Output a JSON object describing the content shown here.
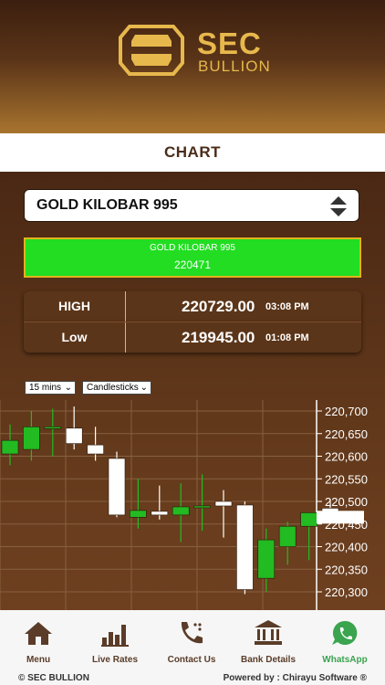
{
  "brand": {
    "line1": "SEC",
    "line2": "BULLION",
    "color": "#e7b84c"
  },
  "page_title": "CHART",
  "product_selector": {
    "value": "GOLD KILOBAR 995"
  },
  "ticker": {
    "name": "GOLD KILOBAR 995",
    "price": "220471",
    "bg": "#22dd22",
    "border": "#e3b21d"
  },
  "stats": {
    "high": {
      "label": "HIGH",
      "value": "220729.00",
      "time": "03:08 PM"
    },
    "low": {
      "label": "Low",
      "value": "219945.00",
      "time": "01:08 PM"
    }
  },
  "controls": {
    "interval": "15 mins",
    "style": "Candlesticks"
  },
  "chart_data": {
    "type": "candlestick",
    "title": "",
    "xlabel": "",
    "ylabel": "",
    "ylim": [
      220290,
      220730
    ],
    "yticks": [
      "220,700",
      "220,650",
      "220,600",
      "220,550",
      "220,500",
      "220,450",
      "220,400",
      "220,350",
      "220,300"
    ],
    "ytick_values": [
      220700,
      220650,
      220600,
      220550,
      220500,
      220450,
      220400,
      220350,
      220300
    ],
    "last_price_label": "",
    "candles": [
      {
        "open": 220605,
        "close": 220635,
        "high": 220670,
        "low": 220580
      },
      {
        "open": 220615,
        "close": 220665,
        "high": 220700,
        "low": 220590
      },
      {
        "open": 220665,
        "close": 220665,
        "high": 220705,
        "low": 220600
      },
      {
        "open": 220662,
        "close": 220628,
        "high": 220710,
        "low": 220615
      },
      {
        "open": 220625,
        "close": 220605,
        "high": 220665,
        "low": 220590
      },
      {
        "open": 220595,
        "close": 220470,
        "high": 220610,
        "low": 220465
      },
      {
        "open": 220465,
        "close": 220480,
        "high": 220550,
        "low": 220440
      },
      {
        "open": 220478,
        "close": 220470,
        "high": 220535,
        "low": 220460
      },
      {
        "open": 220470,
        "close": 220488,
        "high": 220540,
        "low": 220410
      },
      {
        "open": 220490,
        "close": 220490,
        "high": 220560,
        "low": 220435
      },
      {
        "open": 220500,
        "close": 220490,
        "high": 220525,
        "low": 220420
      },
      {
        "open": 220492,
        "close": 220305,
        "high": 220500,
        "low": 220295
      },
      {
        "open": 220330,
        "close": 220415,
        "high": 220440,
        "low": 220300
      },
      {
        "open": 220400,
        "close": 220445,
        "high": 220455,
        "low": 220360
      },
      {
        "open": 220445,
        "close": 220475,
        "high": 220470,
        "low": 220370
      },
      {
        "open": 220485,
        "close": 220465,
        "high": 220505,
        "low": 220450
      }
    ]
  },
  "nav": [
    {
      "label": "Menu",
      "icon": "home-icon"
    },
    {
      "label": "Live Rates",
      "icon": "bar-chart-icon"
    },
    {
      "label": "Contact Us",
      "icon": "phone-icon"
    },
    {
      "label": "Bank Details",
      "icon": "bank-icon"
    },
    {
      "label": "WhatsApp",
      "icon": "whatsapp-icon"
    }
  ],
  "footer": {
    "copyright": "© SEC BULLION",
    "powered": "Powered by : Chirayu Software ®"
  },
  "colors": {
    "up": "#22bb22",
    "down": "#ffffff",
    "icon": "#5a3c28",
    "whatsapp": "#3aa44f"
  }
}
